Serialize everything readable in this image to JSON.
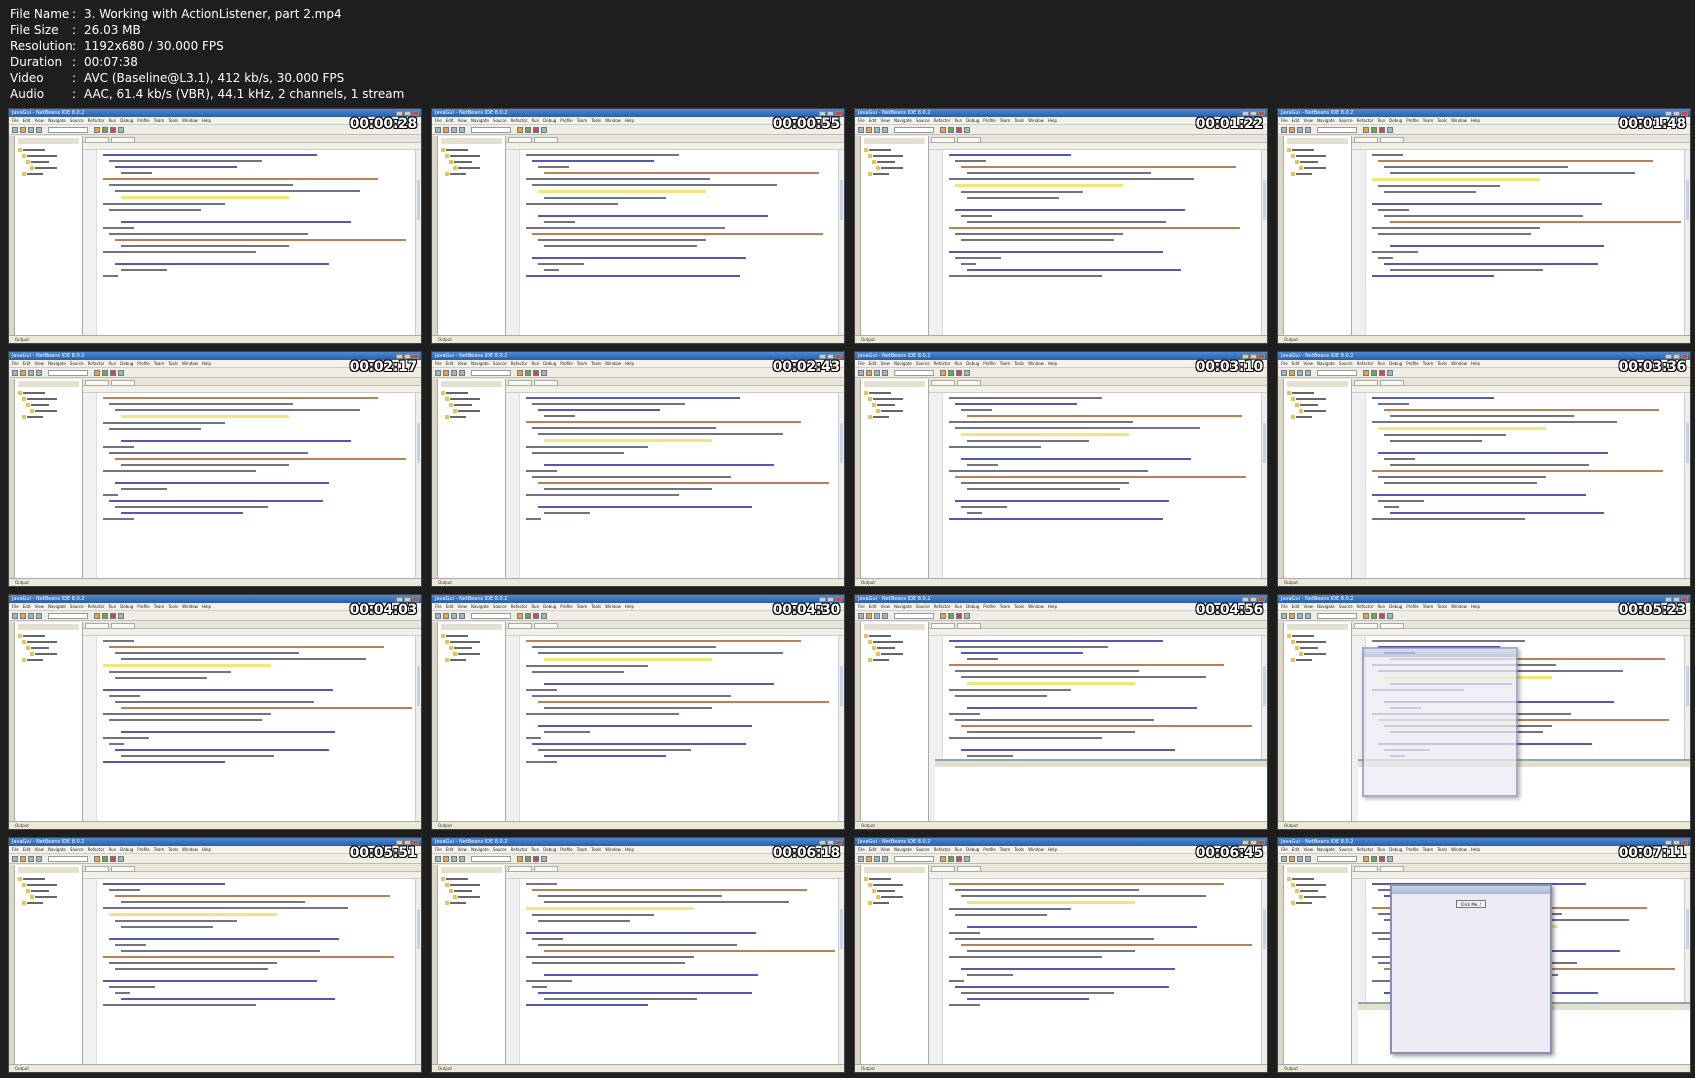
{
  "file_info": {
    "rows": [
      {
        "key": "File Name",
        "value": "3. Working with ActionListener, part 2.mp4"
      },
      {
        "key": "File Size",
        "value": "26.03 MB"
      },
      {
        "key": "Resolution",
        "value": "1192x680 / 30.000 FPS"
      },
      {
        "key": "Duration",
        "value": "00:07:38"
      },
      {
        "key": "Video",
        "value": "AVC (Baseline@L3.1), 412 kb/s, 30.000 FPS"
      },
      {
        "key": "Audio",
        "value": "AAC, 61.4 kb/s (VBR), 44.1 kHz, 2 channels, 1 stream"
      }
    ],
    "separator": ":"
  },
  "thumbnails": [
    {
      "time": "00:00:28",
      "variant": "editor"
    },
    {
      "time": "00:00:55",
      "variant": "editor"
    },
    {
      "time": "00:01:22",
      "variant": "editor"
    },
    {
      "time": "00:01:48",
      "variant": "editor"
    },
    {
      "time": "00:02:17",
      "variant": "editor"
    },
    {
      "time": "00:02:43",
      "variant": "editor"
    },
    {
      "time": "00:03:10",
      "variant": "editor"
    },
    {
      "time": "00:03:36",
      "variant": "editor"
    },
    {
      "time": "00:04:03",
      "variant": "editor"
    },
    {
      "time": "00:04:30",
      "variant": "editor"
    },
    {
      "time": "00:04:56",
      "variant": "output"
    },
    {
      "time": "00:05:23",
      "variant": "dialog"
    },
    {
      "time": "00:05:51",
      "variant": "editor"
    },
    {
      "time": "00:06:18",
      "variant": "editor"
    },
    {
      "time": "00:06:45",
      "variant": "editor"
    },
    {
      "time": "00:07:11",
      "variant": "dialog-button"
    }
  ],
  "ide": {
    "window_title": "JavaGui - NetBeans IDE 8.0.2",
    "menus": [
      "File",
      "Edit",
      "View",
      "Navigate",
      "Source",
      "Refactor",
      "Run",
      "Debug",
      "Profile",
      "Team",
      "Tools",
      "Window",
      "Help"
    ],
    "dialog_button": "Click Me..!",
    "statusbar_label": "Output"
  },
  "colors": {
    "background": "#1e1e1e",
    "ide_chrome": "#ece9d8",
    "titlebar": "#2a5ea8",
    "highlight": "#f0e46a"
  }
}
